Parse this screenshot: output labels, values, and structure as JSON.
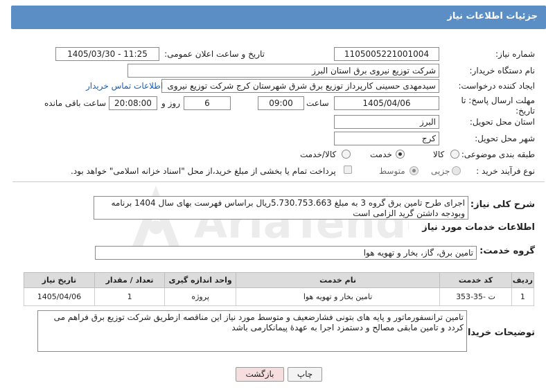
{
  "header": {
    "title": "جزئیات اطلاعات نیاز"
  },
  "fields": {
    "need_number_label": "شماره نیاز:",
    "need_number": "1105005221001004",
    "announce_label": "تاریخ و ساعت اعلان عمومی:",
    "announce_value": "1405/03/30 - 11:25",
    "buyer_org_label": "نام دستگاه خریدار:",
    "buyer_org": "شرکت توزیع نیروی برق استان البرز",
    "creator_label": "ایجاد کننده درخواست:",
    "creator": "سیدمهدی حسینی کارپرداز توزیع برق شرق شهرستان کرج شرکت توزیع نیروی",
    "buyer_contact_link": "اطلاعات تماس خریدار",
    "deadline_label": "مهلت ارسال پاسخ: تا تاریخ:",
    "deadline_date": "1405/04/06",
    "time_label": "ساعت",
    "deadline_time": "09:00",
    "days_value": "6",
    "days_label": "روز و",
    "remaining_time": "20:08:00",
    "remaining_label": "ساعت باقی مانده",
    "province_label": "استان محل تحویل:",
    "province": "البرز",
    "city_label": "شهر محل تحویل:",
    "city": "کرج",
    "category_label": "طبقه بندی موضوعی:",
    "category_options": [
      "کالا",
      "خدمت",
      "کالا/خدمت"
    ],
    "category_selected": "خدمت",
    "process_label": "نوع فرآیند خرید :",
    "process_options": [
      "جزیی",
      "متوسط"
    ],
    "process_selected": "متوسط",
    "payment_note": "پرداخت تمام یا بخشی از مبلغ خرید،از محل \"اسناد خزانه اسلامی\" خواهد بود."
  },
  "summary": {
    "label": "شرح کلی نیاز:",
    "text": "اجرای طرح تامین برق گروه 3 به مبلغ 5.730.753.663ریال براساس فهرست بهای سال 1404 برنامه وبودجه داشتن گرید الزامی است"
  },
  "services": {
    "section_title": "اطلاعات خدمات مورد نیاز",
    "group_label": "گروه خدمت:",
    "group_value": "تامین برق، گاز، بخار و تهویه هوا",
    "columns": [
      "ردیف",
      "کد خدمت",
      "نام خدمت",
      "واحد اندازه گیری",
      "تعداد / مقدار",
      "تاریخ نیاز"
    ],
    "rows": [
      {
        "row": "1",
        "code": "ت -35-353",
        "name": "تامین بخار و تهویه هوا",
        "unit": "پروژه",
        "qty": "1",
        "date": "1405/04/06"
      }
    ]
  },
  "buyer_notes": {
    "label": "توضیحات خریدار:",
    "text": "تامین ترانسفورماتور و پایه های بتونی فشارضعیف و متوسط مورد نیاز این مناقصه ازطریق شرکت توزیع برق فراهم می کردد و تامین مابقی مصالح و دستمزد اجرا به عهدۀ پیمانکارمی باشد"
  },
  "buttons": {
    "print": "چاپ",
    "back": "بازگشت"
  },
  "watermark": "AriaTender.net",
  "colors": {
    "title_bar": "#5b8ec4",
    "back_button": "#f6dede",
    "print_button": "#f3f3f3",
    "link": "#1a5fb4"
  }
}
